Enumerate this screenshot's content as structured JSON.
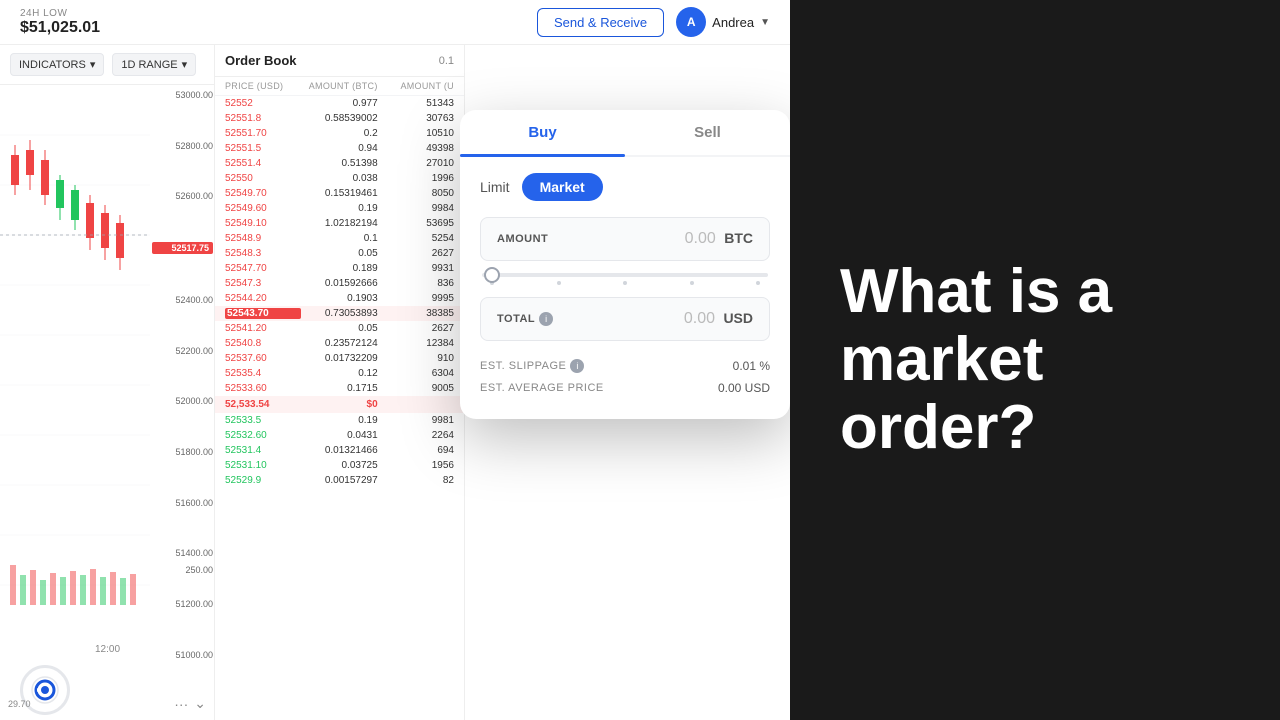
{
  "topBar": {
    "lowLabel": "24H LOW",
    "lowValue": "$51,025.01",
    "sendReceiveBtn": "Send & Receive",
    "userName": "Andrea",
    "userInitial": "A"
  },
  "chart": {
    "toolbar": {
      "indicators": "INDICATORS",
      "range": "1D RANGE"
    },
    "priceLabels": [
      "53000.00",
      "52800.00",
      "52600.00",
      "52400.00",
      "52200.00",
      "52000.00",
      "51800.00",
      "51600.00",
      "51400.00",
      "51200.00",
      "51000.00"
    ],
    "currentPrice": "52517.75",
    "timeLabel": "12:00",
    "volumeLabel": "250.00",
    "bottomPrice": "29.70"
  },
  "orderBook": {
    "title": "Order Book",
    "headerVal": "0.1",
    "columns": [
      "PRICE (USD)",
      "AMOUNT (BTC)",
      "AMOUNT (U"
    ],
    "rows": [
      {
        "price": "52552",
        "amount": "0.977",
        "total": "51343"
      },
      {
        "price": "52551.8",
        "amount": "0.58539002",
        "total": "30763"
      },
      {
        "price": "52551.70",
        "amount": "0.2",
        "total": "10510"
      },
      {
        "price": "52551.5",
        "amount": "0.94",
        "total": "49398"
      },
      {
        "price": "52551.4",
        "amount": "0.51398",
        "total": "27010"
      },
      {
        "price": "52550",
        "amount": "0.038",
        "total": "1996"
      },
      {
        "price": "52549.70",
        "amount": "0.15319461",
        "total": "8050"
      },
      {
        "price": "52549.60",
        "amount": "0.19",
        "total": "9984"
      },
      {
        "price": "52549.10",
        "amount": "1.02182194",
        "total": "53695"
      },
      {
        "price": "52548.9",
        "amount": "0.1",
        "total": "5254"
      },
      {
        "price": "52548.3",
        "amount": "0.05",
        "total": "2627"
      },
      {
        "price": "52547.70",
        "amount": "0.189",
        "total": "9931"
      },
      {
        "price": "52547.3",
        "amount": "0.01592666",
        "total": "836"
      },
      {
        "price": "52544.20",
        "amount": "0.1903",
        "total": "9995"
      },
      {
        "price": "52543.70",
        "amount": "0.73053893",
        "total": "38385",
        "highlighted": true
      },
      {
        "price": "52541.20",
        "amount": "0.05",
        "total": "2627"
      },
      {
        "price": "52540.8",
        "amount": "0.23572124",
        "total": "12384"
      },
      {
        "price": "52537.60",
        "amount": "0.01732209",
        "total": "910"
      },
      {
        "price": "52535.4",
        "amount": "0.12",
        "total": "6304"
      },
      {
        "price": "52533.60",
        "amount": "0.1715",
        "total": "9005"
      }
    ],
    "spreadRow": {
      "price": "52,533.54",
      "amount": "$0",
      "total": ""
    },
    "bottomRows": [
      {
        "price": "52533.5",
        "amount": "0.19",
        "total": "9981"
      },
      {
        "price": "52532.60",
        "amount": "0.0431",
        "total": "2264"
      },
      {
        "price": "52531.4",
        "amount": "0.01321466",
        "total": "694"
      },
      {
        "price": "52531.10",
        "amount": "0.03725",
        "total": "1956"
      },
      {
        "price": "52529.9",
        "amount": "0.00157297",
        "total": "82"
      }
    ]
  },
  "orderForm": {
    "tabs": [
      "Buy",
      "Sell"
    ],
    "activeTab": "Buy",
    "orderTypes": [
      "Limit",
      "Market"
    ],
    "activeOrderType": "Market",
    "amountLabel": "AMOUNT",
    "amountValue": "0.00",
    "amountCurrency": "BTC",
    "totalLabel": "TOTAL",
    "totalValue": "0.00",
    "totalCurrency": "USD",
    "estSlippageLabel": "EST. SLIPPAGE",
    "estSlippageValue": "0.01 %",
    "estAvgPriceLabel": "EST. AVERAGE PRICE",
    "estAvgPriceValue": "0.00 USD"
  },
  "rightPanel": {
    "headline": "What is a market order?"
  }
}
